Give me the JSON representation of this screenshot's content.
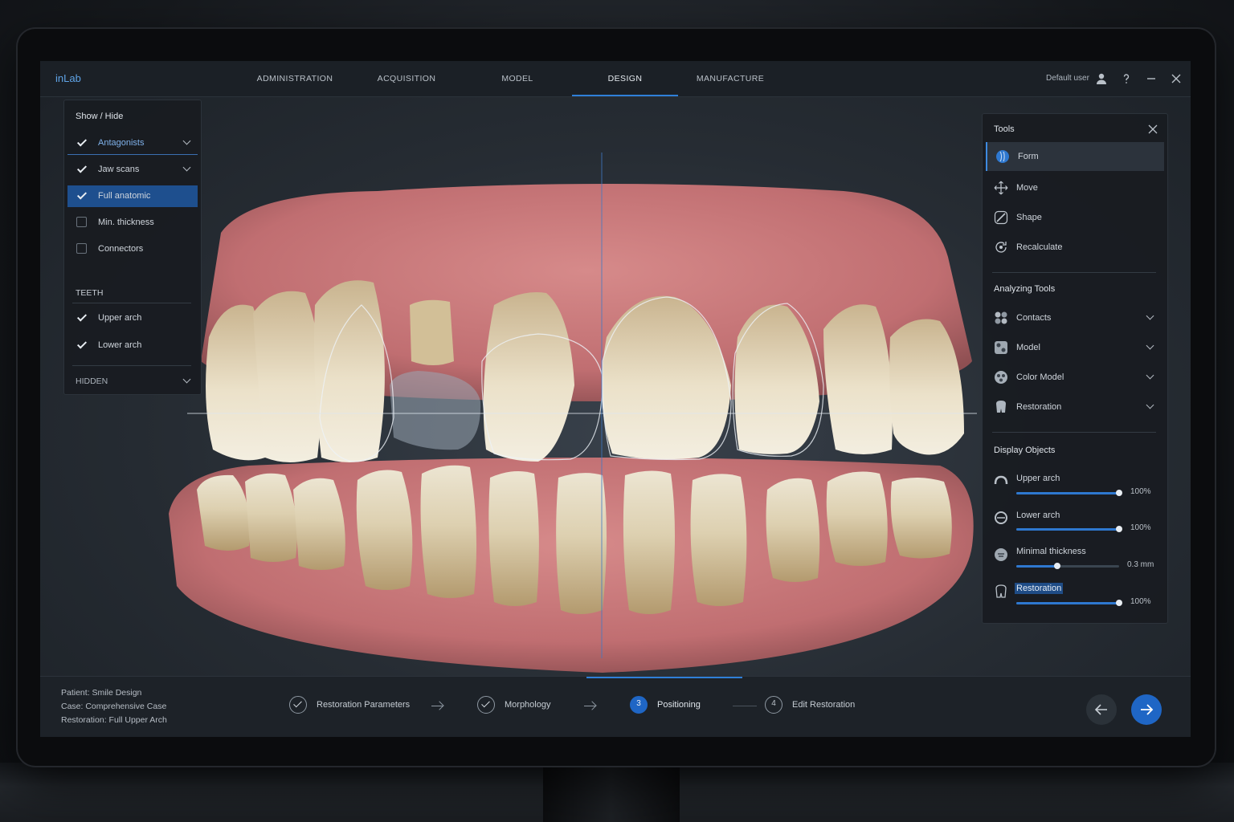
{
  "app": {
    "brand": "inLab"
  },
  "nav": {
    "tabs": [
      {
        "label": "ADMINISTRATION"
      },
      {
        "label": "ACQUISITION"
      },
      {
        "label": "MODEL"
      },
      {
        "label": "DESIGN",
        "active": true
      },
      {
        "label": "MANUFACTURE"
      }
    ],
    "user_label": "Default user"
  },
  "show_hide": {
    "title": "Show / Hide",
    "items": [
      {
        "label": "Antagonists",
        "checked": true
      },
      {
        "label": "Jaw scans",
        "checked": true
      },
      {
        "label": "Full anatomic",
        "checked": true
      },
      {
        "label": "Min. thickness",
        "checked": false
      },
      {
        "label": "Connectors",
        "checked": false
      }
    ],
    "teeth_header": "TEETH",
    "teeth": [
      {
        "label": "Upper arch",
        "checked": true
      },
      {
        "label": "Lower arch",
        "checked": true
      }
    ],
    "hidden_label": "HIDDEN"
  },
  "tools": {
    "title": "Tools",
    "items": [
      {
        "label": "Form",
        "icon": "form-icon"
      },
      {
        "label": "Move",
        "icon": "move-icon"
      },
      {
        "label": "Shape",
        "icon": "shape-icon"
      },
      {
        "label": "Recalculate",
        "icon": "recalculate-icon"
      }
    ],
    "analyzing_title": "Analyzing Tools",
    "analyzing": [
      {
        "label": "Contacts"
      },
      {
        "label": "Model"
      },
      {
        "label": "Color Model"
      },
      {
        "label": "Restoration"
      }
    ],
    "display_title": "Display Objects",
    "display": [
      {
        "label": "Upper arch",
        "value_text": "100%",
        "level": 1.0
      },
      {
        "label": "Lower arch",
        "value_text": "100%",
        "level": 1.0
      },
      {
        "label": "Minimal thickness",
        "value_text": "0.3 mm",
        "level": 0.4
      },
      {
        "label": "Restoration",
        "value_text": "100%",
        "level": 1.0
      }
    ]
  },
  "footer": {
    "patient": "Patient: Smile Design",
    "case": "Case: Comprehensive Case",
    "restoration": "Restoration: Full Upper Arch",
    "steps": [
      {
        "label": "Restoration Parameters",
        "state": "done"
      },
      {
        "label": "Morphology",
        "state": "done"
      },
      {
        "label": "Positioning",
        "state": "current",
        "number": "3"
      },
      {
        "label": "Edit Restoration",
        "state": "todo",
        "number": "4"
      }
    ]
  },
  "colors": {
    "accent": "#2f7fd8",
    "selected_row": "#1e4f8e",
    "gum": "#c9787a",
    "tooth": "#e7dcc3"
  }
}
